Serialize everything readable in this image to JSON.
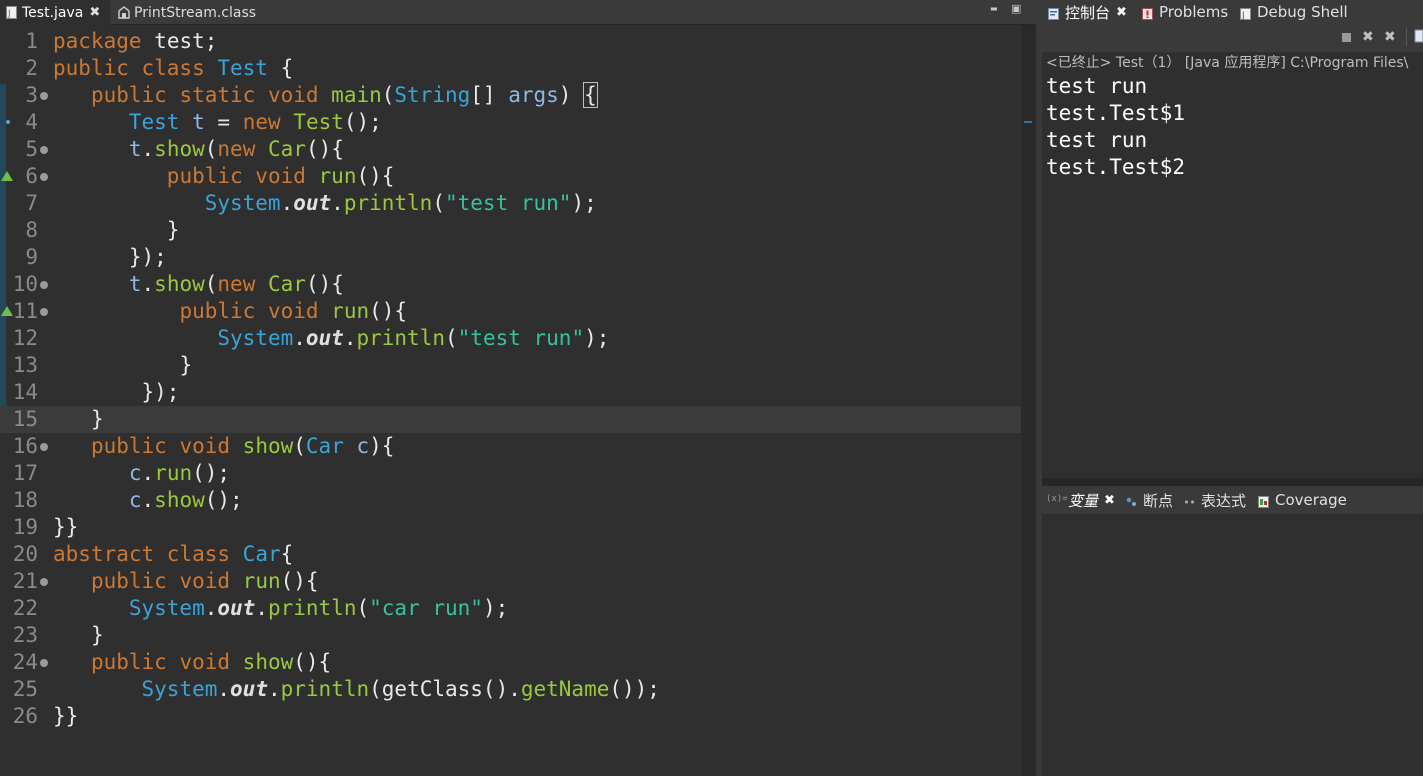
{
  "editor": {
    "tabs": [
      {
        "label": "Test.java",
        "active": true,
        "icon": "java-file-icon"
      },
      {
        "label": "PrintStream.class",
        "active": false,
        "icon": "class-file-icon"
      }
    ],
    "controls": {
      "minimize": "▬",
      "maximize": "▣"
    }
  },
  "code_lines": [
    {
      "n": "1",
      "html": "<span class='kw'>package</span> <span class='pl'>test;</span>"
    },
    {
      "n": "2",
      "html": "<span class='kw'>public class</span> <span class='ty'>Test</span> <span class='pl'>{</span>"
    },
    {
      "n": "3",
      "fold": true,
      "html": "   <span class='kw'>public static void</span> <span class='fn'>main</span><span class='pl'>(</span><span class='ty'>String</span><span class='pl'>[] </span><span class='va'>args</span><span class='pl'>) </span><span class='pl br'>{</span>"
    },
    {
      "n": "4",
      "dot": true,
      "html": "      <span class='ty'>Test</span> <span class='va'>t</span> <span class='pl'>=</span> <span class='kw'>new</span> <span class='fn'>Test</span><span class='pl'>();</span>"
    },
    {
      "n": "5",
      "fold": true,
      "html": "      <span class='va'>t</span><span class='pl'>.</span><span class='fn'>show</span><span class='pl'>(</span><span class='kw'>new</span> <span class='fn'>Car</span><span class='pl'>(){</span>"
    },
    {
      "n": "6",
      "fold": true,
      "override": true,
      "html": "         <span class='kw'>public void</span> <span class='fn'>run</span><span class='pl'>(){</span>"
    },
    {
      "n": "7",
      "html": "            <span class='ty'>System</span><span class='pl'>.</span><span class='it'>out</span><span class='pl'>.</span><span class='fn'>println</span><span class='pl'>(</span><span class='st'>\"test run\"</span><span class='pl'>);</span>"
    },
    {
      "n": "8",
      "html": "         <span class='pl'>}</span>"
    },
    {
      "n": "9",
      "html": "      <span class='pl'>});</span>"
    },
    {
      "n": "10",
      "fold": true,
      "html": "      <span class='va'>t</span><span class='pl'>.</span><span class='fn'>show</span><span class='pl'>(</span><span class='kw'>new</span> <span class='fn'>Car</span><span class='pl'>(){</span>"
    },
    {
      "n": "11",
      "fold": true,
      "override": true,
      "html": "          <span class='kw'>public void</span> <span class='fn'>run</span><span class='pl'>(){</span>"
    },
    {
      "n": "12",
      "html": "             <span class='ty'>System</span><span class='pl'>.</span><span class='it'>out</span><span class='pl'>.</span><span class='fn'>println</span><span class='pl'>(</span><span class='st'>\"test run\"</span><span class='pl'>);</span>"
    },
    {
      "n": "13",
      "html": "          <span class='pl'>}</span>"
    },
    {
      "n": "14",
      "html": "       <span class='pl'>});</span>"
    },
    {
      "n": "15",
      "current": true,
      "html": "   <span class='pl'>}</span>"
    },
    {
      "n": "16",
      "fold": true,
      "html": "   <span class='kw'>public void</span> <span class='fn'>show</span><span class='pl'>(</span><span class='ty'>Car</span> <span class='va'>c</span><span class='pl'>){</span>"
    },
    {
      "n": "17",
      "html": "      <span class='va'>c</span><span class='pl'>.</span><span class='fn'>run</span><span class='pl'>();</span>"
    },
    {
      "n": "18",
      "html": "      <span class='va'>c</span><span class='pl'>.</span><span class='fn'>show</span><span class='pl'>();</span>"
    },
    {
      "n": "19",
      "html": "<span class='pl'>}}</span>"
    },
    {
      "n": "20",
      "html": "<span class='kw'>abstract class</span> <span class='ty'>Car</span><span class='pl'>{</span>"
    },
    {
      "n": "21",
      "fold": true,
      "html": "   <span class='kw'>public void</span> <span class='fn'>run</span><span class='pl'>(){</span>"
    },
    {
      "n": "22",
      "html": "      <span class='ty'>System</span><span class='pl'>.</span><span class='it'>out</span><span class='pl'>.</span><span class='fn'>println</span><span class='pl'>(</span><span class='st'>\"car run\"</span><span class='pl'>);</span>"
    },
    {
      "n": "23",
      "html": "   <span class='pl'>}</span>"
    },
    {
      "n": "24",
      "fold": true,
      "html": "   <span class='kw'>public void</span> <span class='fn'>show</span><span class='pl'>(){</span>"
    },
    {
      "n": "25",
      "html": "       <span class='ty'>System</span><span class='pl'>.</span><span class='it'>out</span><span class='pl'>.</span><span class='fn'>println</span><span class='pl'>(getClass().</span><span class='fn'>getName</span><span class='pl'>());</span>"
    },
    {
      "n": "26",
      "html": "<span class='pl'>}}</span>"
    }
  ],
  "console": {
    "tabs": [
      {
        "label": "控制台",
        "active": true,
        "icon": "console-icon"
      },
      {
        "label": "Problems",
        "active": false,
        "icon": "problems-icon"
      },
      {
        "label": "Debug Shell",
        "active": false,
        "icon": "debug-shell-icon"
      }
    ],
    "status": "<已终止> Test（1） [Java 应用程序] C:\\Program Files\\",
    "output": [
      "test run",
      "test.Test$1",
      "test run",
      "test.Test$2"
    ]
  },
  "debug_panel": {
    "tabs": [
      {
        "label": "变量",
        "active": true,
        "icon": "variables-icon"
      },
      {
        "label": "断点",
        "active": false,
        "icon": "breakpoints-icon"
      },
      {
        "label": "表达式",
        "active": false,
        "icon": "expressions-icon"
      },
      {
        "label": "Coverage",
        "active": false,
        "icon": "coverage-icon"
      }
    ]
  },
  "colors": {
    "background": "#2f2f2f",
    "keyword": "#cc7832",
    "type": "#3aa4d8",
    "method": "#9ac93b",
    "string": "#34c3a0"
  }
}
